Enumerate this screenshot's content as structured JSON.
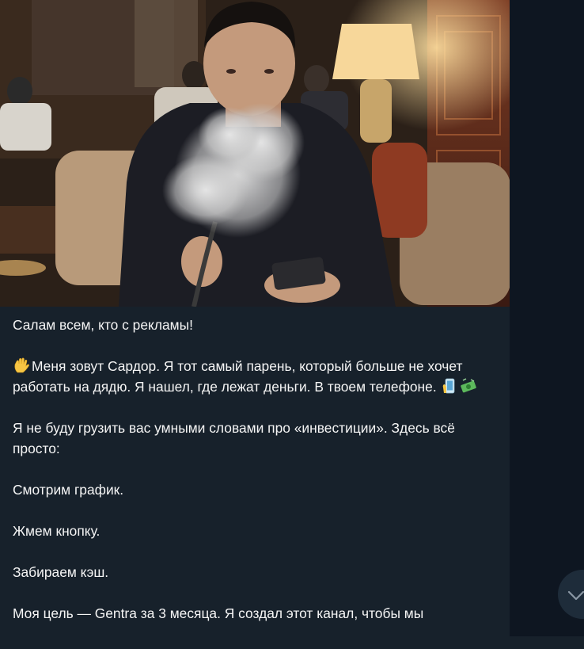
{
  "message": {
    "photo_alt": "",
    "greeting": "Салам всем, кто с рекламы!",
    "intro": "Меня зовут Сардор. Я тот самый парень, который больше не хочет работать на дядю. Я нашел, где лежат деньги. В твоем телефоне.",
    "intro_emoji": "waving-hand-icon",
    "intro_trailing_emojis": [
      "phone-icon",
      "money-icon"
    ],
    "para2": "Я не буду грузить вас умными словами про «инвестиции». Здесь всё просто:",
    "step1": "Смотрим график.",
    "step2": "Жмем кнопку.",
    "step3": "Забираем кэш.",
    "goal": "Моя цель — Gentra за 3 месяца. Я создал этот канал, чтобы мы"
  },
  "colors": {
    "chat_background": "#0e1621",
    "bubble_background": "#17212b",
    "text": "#f5f5f5",
    "scroll_button": "#1e2c3a"
  },
  "controls": {
    "scroll_down_icon": "chevron-down-icon"
  }
}
